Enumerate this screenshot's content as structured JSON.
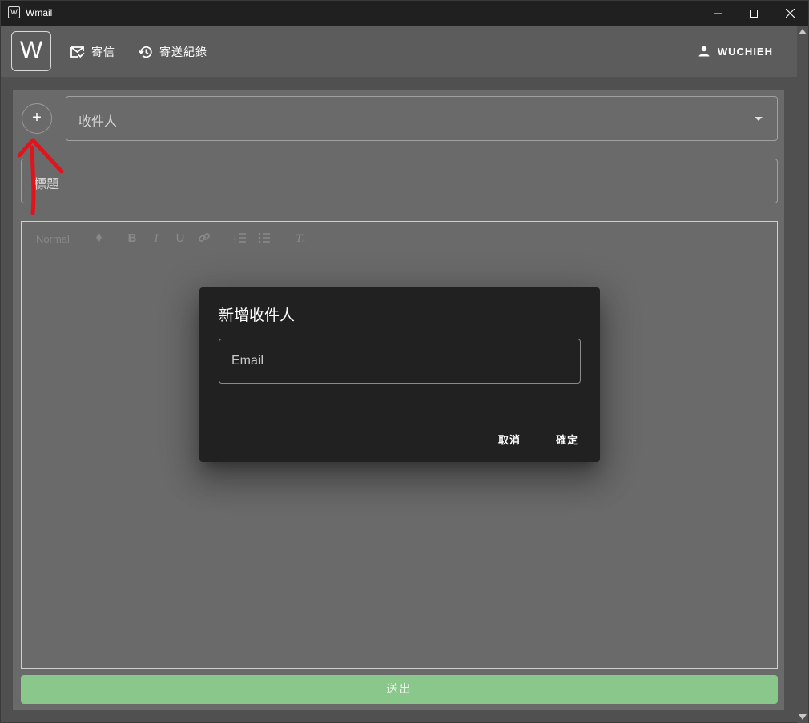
{
  "window": {
    "title": "Wmail",
    "icon_letter": "W"
  },
  "appbar": {
    "logo": "W",
    "nav": [
      {
        "label": "寄信",
        "icon": "mail-check-icon"
      },
      {
        "label": "寄送紀錄",
        "icon": "history-icon"
      }
    ],
    "user": {
      "label": "WUCHIEH",
      "icon": "person-icon"
    }
  },
  "compose": {
    "add_recipient": "+",
    "recipient_label": "收件人",
    "subject_label": "標題",
    "editor": {
      "font_select": "Normal"
    },
    "send_label": "送出"
  },
  "dialog": {
    "title": "新增收件人",
    "email_label": "Email",
    "cancel_label": "取消",
    "ok_label": "確定"
  },
  "colors": {
    "send_button": "#89c88a",
    "annotation": "#e0141e",
    "dialog_bg": "#212121"
  }
}
